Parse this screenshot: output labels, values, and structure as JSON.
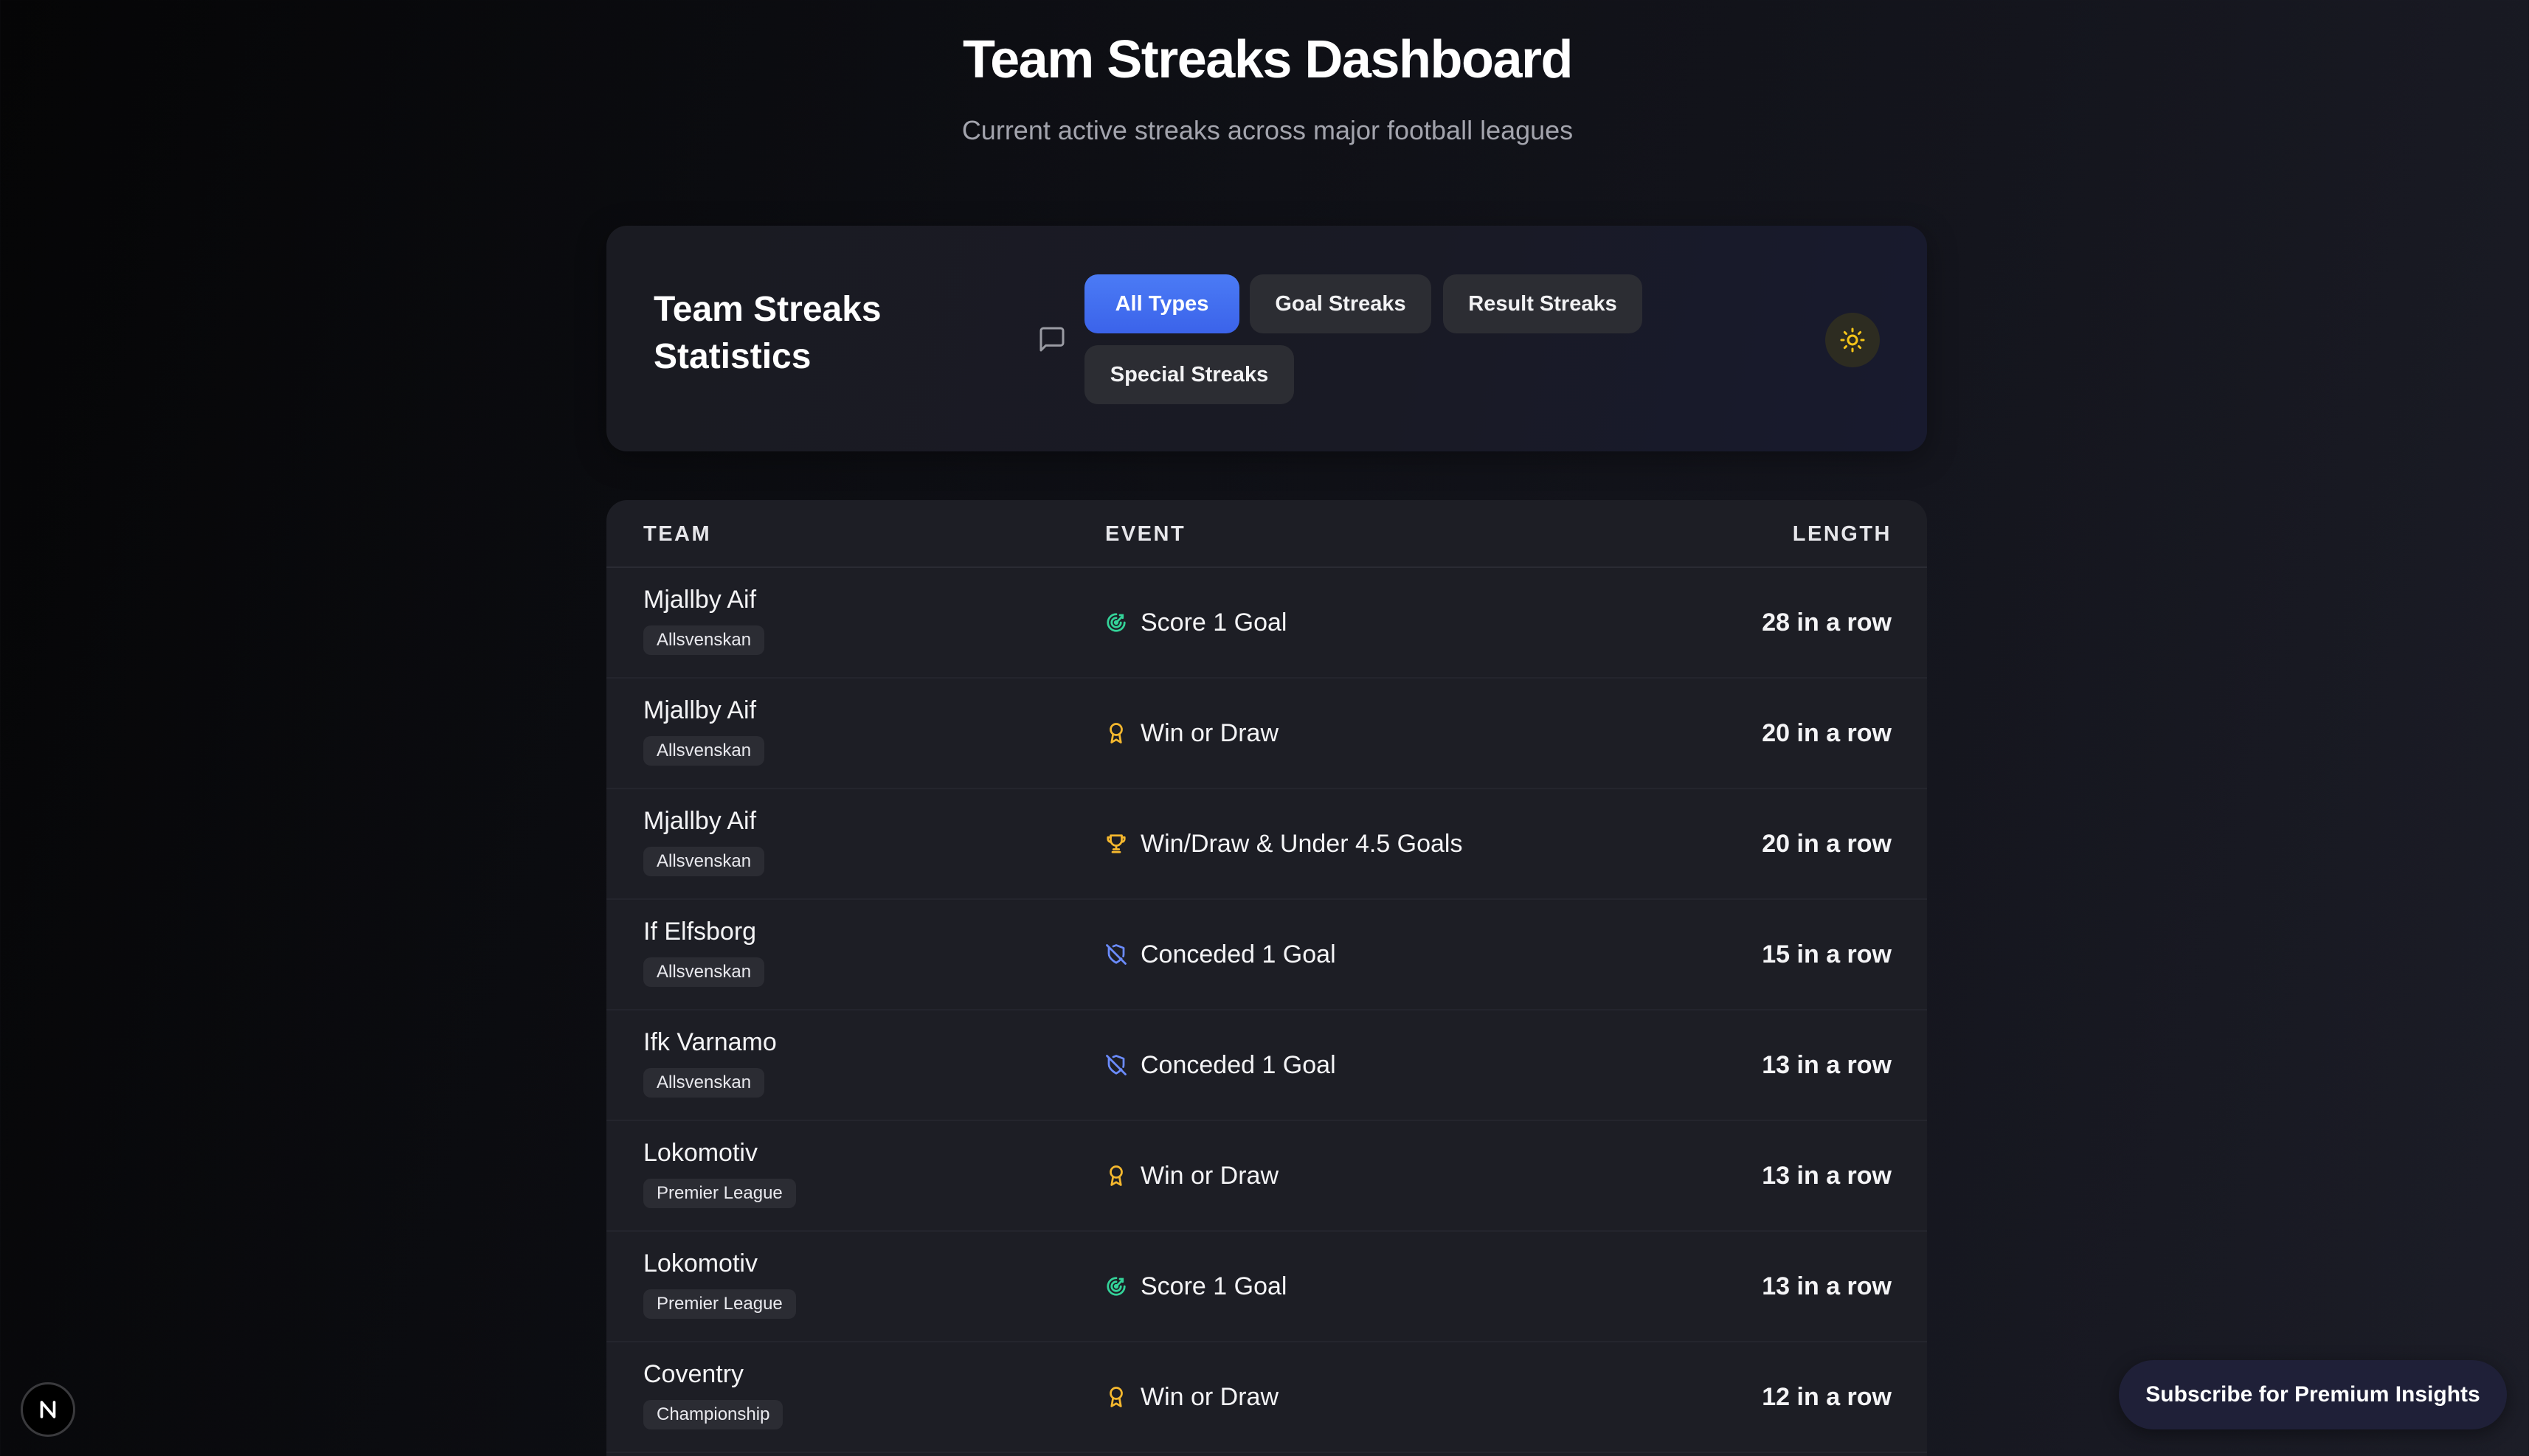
{
  "header": {
    "title": "Team Streaks Dashboard",
    "subtitle": "Current active streaks across major football leagues"
  },
  "filter_panel": {
    "title": "Team Streaks Statistics",
    "comment_icon": "message-square-icon",
    "theme_icon": "sun-icon",
    "filters": [
      {
        "label": "All Types",
        "active": true
      },
      {
        "label": "Goal Streaks",
        "active": false
      },
      {
        "label": "Result Streaks",
        "active": false
      },
      {
        "label": "Special Streaks",
        "active": false
      }
    ]
  },
  "table": {
    "columns": [
      "TEAM",
      "EVENT",
      "LENGTH"
    ],
    "rows": [
      {
        "team": "Mjallby Aif",
        "league": "Allsvenskan",
        "event": "Score 1 Goal",
        "icon": "target-icon",
        "length": "28 in a row"
      },
      {
        "team": "Mjallby Aif",
        "league": "Allsvenskan",
        "event": "Win or Draw",
        "icon": "award-icon",
        "length": "20 in a row"
      },
      {
        "team": "Mjallby Aif",
        "league": "Allsvenskan",
        "event": "Win/Draw & Under 4.5 Goals",
        "icon": "trophy-icon",
        "length": "20 in a row"
      },
      {
        "team": "If Elfsborg",
        "league": "Allsvenskan",
        "event": "Conceded 1 Goal",
        "icon": "shield-off-icon",
        "length": "15 in a row"
      },
      {
        "team": "Ifk Varnamo",
        "league": "Allsvenskan",
        "event": "Conceded 1 Goal",
        "icon": "shield-off-icon",
        "length": "13 in a row"
      },
      {
        "team": "Lokomotiv",
        "league": "Premier League",
        "event": "Win or Draw",
        "icon": "award-icon",
        "length": "13 in a row"
      },
      {
        "team": "Lokomotiv",
        "league": "Premier League",
        "event": "Score 1 Goal",
        "icon": "target-icon",
        "length": "13 in a row"
      },
      {
        "team": "Coventry",
        "league": "Championship",
        "event": "Win or Draw",
        "icon": "award-icon",
        "length": "12 in a row"
      }
    ]
  },
  "footer": {
    "next_logo_letter": "N",
    "subscribe_label": "Subscribe for Premium Insights"
  },
  "colors": {
    "accent_blue": "#3b63ea",
    "goal_green": "#34d399",
    "gold": "#f5b82e",
    "shield_blue": "#6b8cff"
  }
}
